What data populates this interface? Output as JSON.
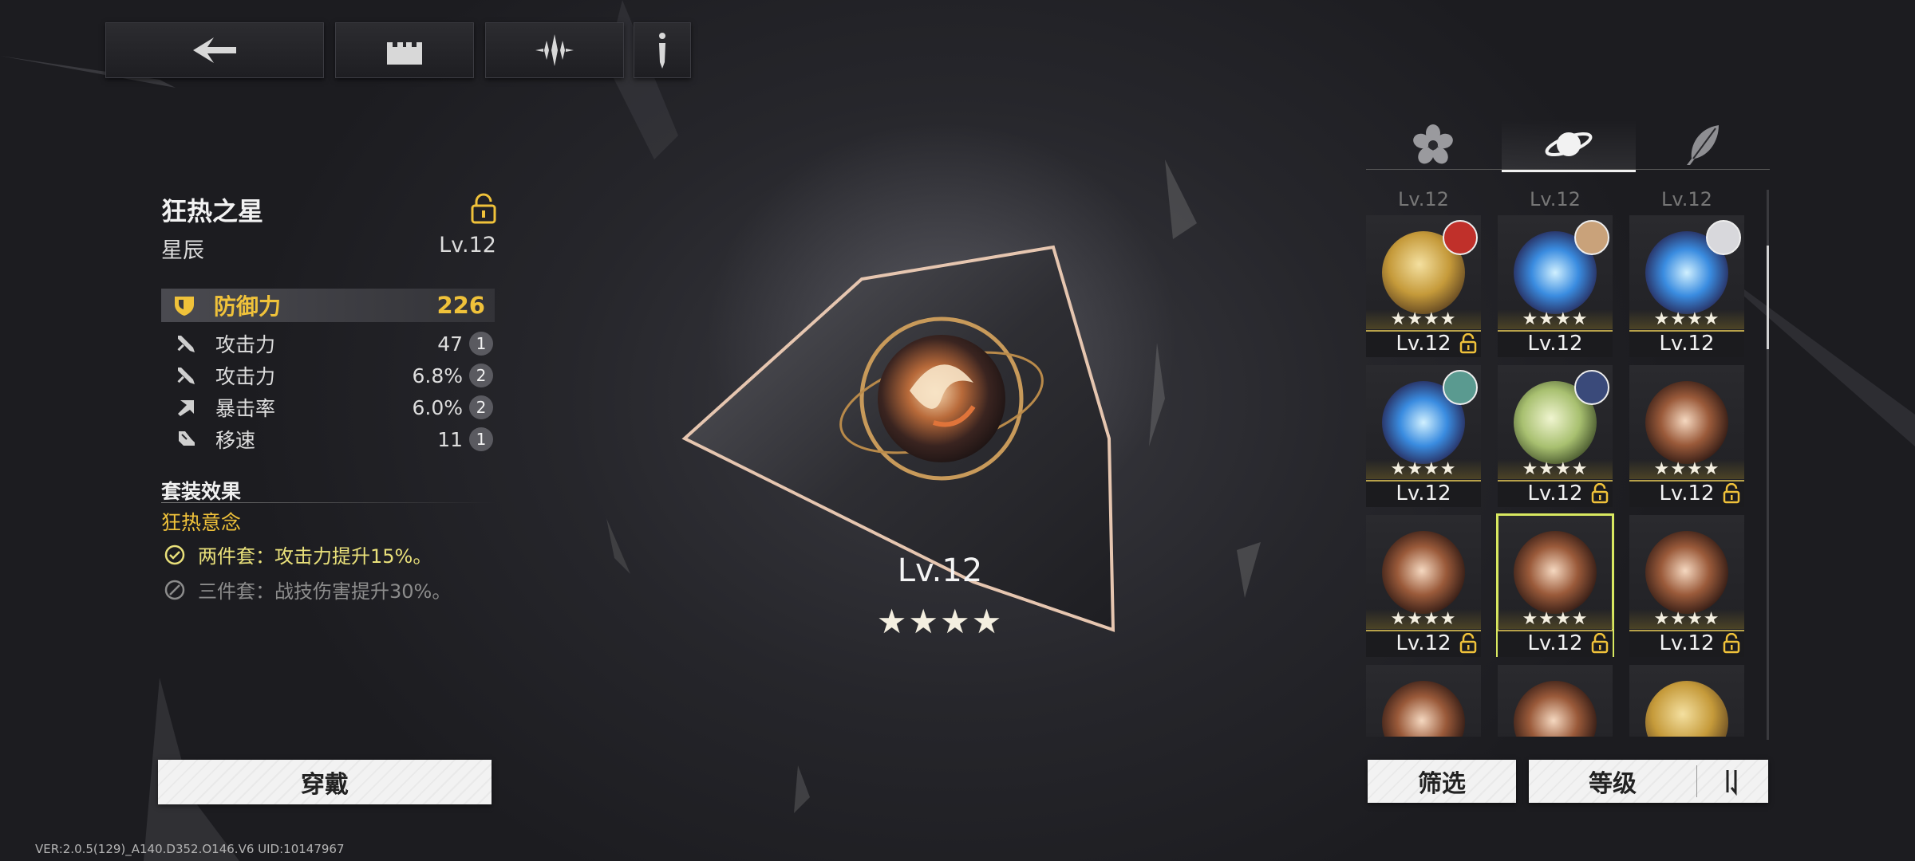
{
  "item": {
    "name": "狂热之星",
    "type": "星辰",
    "level": "Lv.12",
    "main_stat": {
      "label": "防御力",
      "value": "226"
    },
    "sub_stats": [
      {
        "label": "攻击力",
        "value": "47",
        "count": "1",
        "icon": "sword-icon"
      },
      {
        "label": "攻击力",
        "value": "6.8%",
        "count": "2",
        "icon": "sword-icon"
      },
      {
        "label": "暴击率",
        "value": "6.0%",
        "count": "2",
        "icon": "crit-arrow-icon"
      },
      {
        "label": "移速",
        "value": "11",
        "count": "1",
        "icon": "boot-icon"
      }
    ],
    "set_title": "套装效果",
    "set_name": "狂热意念",
    "set_effects": [
      {
        "text": "两件套：攻击力提升15%。",
        "active": true
      },
      {
        "text": "三件套：战技伤害提升30%。",
        "active": false
      }
    ]
  },
  "center": {
    "level": "Lv.12",
    "stars": "★★★★"
  },
  "buttons": {
    "equip": "穿戴",
    "filter": "筛选",
    "sort": "等级"
  },
  "tabs": [
    "flower-icon",
    "planet-icon",
    "feather-icon"
  ],
  "grid": {
    "peek_labels": [
      "Lv.12",
      "Lv.12",
      "Lv.12"
    ],
    "cells": [
      {
        "level": "Lv.12",
        "stars": "★★★★",
        "locked": true,
        "orb": "gold",
        "avatar": "red"
      },
      {
        "level": "Lv.12",
        "stars": "★★★★",
        "locked": false,
        "orb": "blue",
        "avatar": "tan"
      },
      {
        "level": "Lv.12",
        "stars": "★★★★",
        "locked": false,
        "orb": "blue",
        "avatar": "white"
      },
      {
        "level": "Lv.12",
        "stars": "★★★★",
        "locked": false,
        "orb": "blue",
        "avatar": "teal"
      },
      {
        "level": "Lv.12",
        "stars": "★★★★",
        "locked": true,
        "orb": "green",
        "avatar": "navy"
      },
      {
        "level": "Lv.12",
        "stars": "★★★★",
        "locked": true,
        "orb": "bronze",
        "avatar": ""
      },
      {
        "level": "Lv.12",
        "stars": "★★★★",
        "locked": true,
        "orb": "bronze",
        "avatar": ""
      },
      {
        "level": "Lv.12",
        "stars": "★★★★",
        "locked": true,
        "orb": "bronze",
        "avatar": "",
        "selected": true
      },
      {
        "level": "Lv.12",
        "stars": "★★★★",
        "locked": true,
        "orb": "bronze",
        "avatar": ""
      },
      {
        "level": "",
        "stars": "",
        "locked": false,
        "orb": "bronze",
        "avatar": ""
      },
      {
        "level": "",
        "stars": "",
        "locked": false,
        "orb": "bronze",
        "avatar": ""
      },
      {
        "level": "",
        "stars": "",
        "locked": false,
        "orb": "gold",
        "avatar": ""
      }
    ]
  },
  "colors": {
    "accent": "#f0c23a",
    "active_set": "#e9e07a",
    "select_outline": "#d8e860"
  },
  "version": "VER:2.0.5(129)_A140.D352.O146.V6    UID:10147967"
}
